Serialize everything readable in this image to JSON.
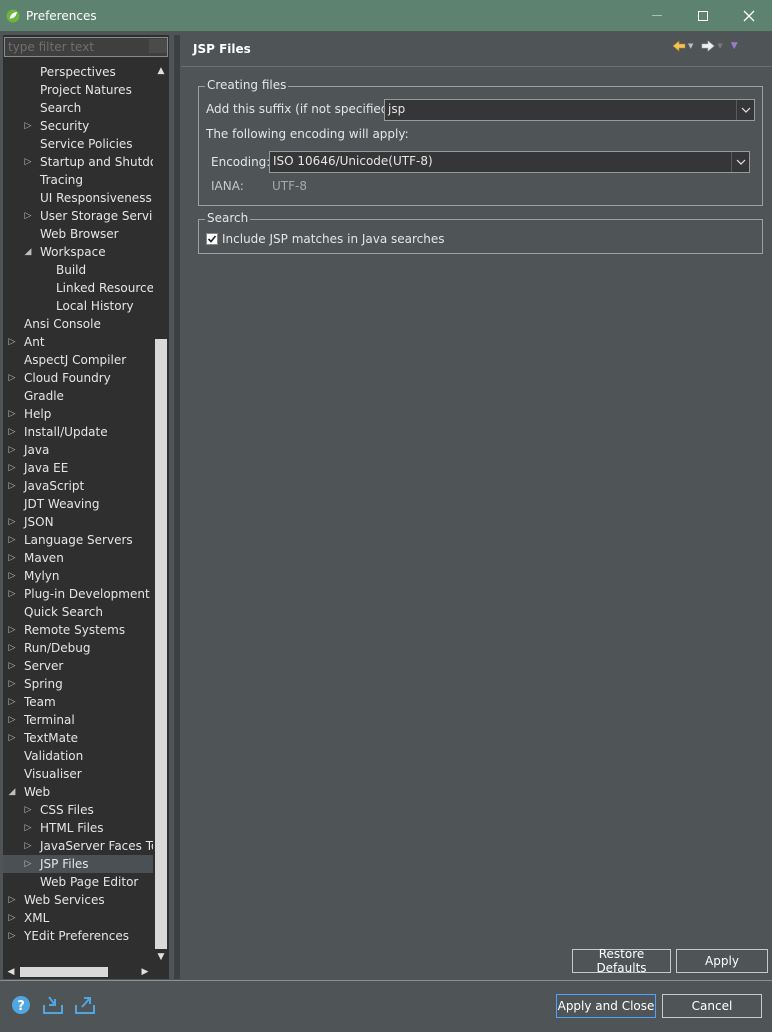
{
  "window": {
    "title": "Preferences"
  },
  "colors": {
    "titlebar": "#5d8270",
    "accent_icon": "#4fa6e0",
    "nav_arrow": "#f3c35a"
  },
  "left": {
    "filter_placeholder": "type filter text",
    "tree": [
      {
        "label": "Perspectives",
        "level": 2,
        "arrow": ""
      },
      {
        "label": "Project Natures",
        "level": 2,
        "arrow": ""
      },
      {
        "label": "Search",
        "level": 2,
        "arrow": ""
      },
      {
        "label": "Security",
        "level": 2,
        "arrow": "collapsed"
      },
      {
        "label": "Service Policies",
        "level": 2,
        "arrow": ""
      },
      {
        "label": "Startup and Shutdown",
        "level": 2,
        "arrow": "collapsed"
      },
      {
        "label": "Tracing",
        "level": 2,
        "arrow": ""
      },
      {
        "label": "UI Responsiveness Monitoring",
        "level": 2,
        "arrow": ""
      },
      {
        "label": "User Storage Service",
        "level": 2,
        "arrow": "collapsed"
      },
      {
        "label": "Web Browser",
        "level": 2,
        "arrow": ""
      },
      {
        "label": "Workspace",
        "level": 2,
        "arrow": "expanded"
      },
      {
        "label": "Build",
        "level": 3,
        "arrow": ""
      },
      {
        "label": "Linked Resources",
        "level": 3,
        "arrow": ""
      },
      {
        "label": "Local History",
        "level": 3,
        "arrow": ""
      },
      {
        "label": "Ansi Console",
        "level": 1,
        "arrow": ""
      },
      {
        "label": "Ant",
        "level": 1,
        "arrow": "collapsed"
      },
      {
        "label": "AspectJ Compiler",
        "level": 1,
        "arrow": ""
      },
      {
        "label": "Cloud Foundry",
        "level": 1,
        "arrow": "collapsed"
      },
      {
        "label": "Gradle",
        "level": 1,
        "arrow": ""
      },
      {
        "label": "Help",
        "level": 1,
        "arrow": "collapsed"
      },
      {
        "label": "Install/Update",
        "level": 1,
        "arrow": "collapsed"
      },
      {
        "label": "Java",
        "level": 1,
        "arrow": "collapsed"
      },
      {
        "label": "Java EE",
        "level": 1,
        "arrow": "collapsed"
      },
      {
        "label": "JavaScript",
        "level": 1,
        "arrow": "collapsed"
      },
      {
        "label": "JDT Weaving",
        "level": 1,
        "arrow": ""
      },
      {
        "label": "JSON",
        "level": 1,
        "arrow": "collapsed"
      },
      {
        "label": "Language Servers",
        "level": 1,
        "arrow": "collapsed"
      },
      {
        "label": "Maven",
        "level": 1,
        "arrow": "collapsed"
      },
      {
        "label": "Mylyn",
        "level": 1,
        "arrow": "collapsed"
      },
      {
        "label": "Plug-in Development",
        "level": 1,
        "arrow": "collapsed"
      },
      {
        "label": "Quick Search",
        "level": 1,
        "arrow": ""
      },
      {
        "label": "Remote Systems",
        "level": 1,
        "arrow": "collapsed"
      },
      {
        "label": "Run/Debug",
        "level": 1,
        "arrow": "collapsed"
      },
      {
        "label": "Server",
        "level": 1,
        "arrow": "collapsed"
      },
      {
        "label": "Spring",
        "level": 1,
        "arrow": "collapsed"
      },
      {
        "label": "Team",
        "level": 1,
        "arrow": "collapsed"
      },
      {
        "label": "Terminal",
        "level": 1,
        "arrow": "collapsed"
      },
      {
        "label": "TextMate",
        "level": 1,
        "arrow": "collapsed"
      },
      {
        "label": "Validation",
        "level": 1,
        "arrow": ""
      },
      {
        "label": "Visualiser",
        "level": 1,
        "arrow": ""
      },
      {
        "label": "Web",
        "level": 1,
        "arrow": "expanded"
      },
      {
        "label": "CSS Files",
        "level": 2,
        "arrow": "collapsed"
      },
      {
        "label": "HTML Files",
        "level": 2,
        "arrow": "collapsed"
      },
      {
        "label": "JavaServer Faces Tools",
        "level": 2,
        "arrow": "collapsed"
      },
      {
        "label": "JSP Files",
        "level": 2,
        "arrow": "collapsed",
        "selected": true
      },
      {
        "label": "Web Page Editor",
        "level": 2,
        "arrow": ""
      },
      {
        "label": "Web Services",
        "level": 1,
        "arrow": "collapsed"
      },
      {
        "label": "XML",
        "level": 1,
        "arrow": "collapsed"
      },
      {
        "label": "YEdit Preferences",
        "level": 1,
        "arrow": "collapsed"
      }
    ]
  },
  "page": {
    "title": "JSP Files",
    "creating_files": {
      "group_label": "Creating files",
      "suffix_label": "Add this suffix (if not specified):",
      "suffix_value": "jsp",
      "encoding_note": "The following encoding will apply:",
      "encoding_label": "Encoding:",
      "encoding_value": "ISO 10646/Unicode(UTF-8)",
      "iana_label": "IANA:",
      "iana_value": "UTF-8"
    },
    "search": {
      "group_label": "Search",
      "checkbox_label": "Include JSP matches in Java searches",
      "checked": true
    },
    "restore_defaults": "Restore Defaults",
    "apply": "Apply"
  },
  "footer": {
    "apply_close": "Apply and Close",
    "cancel": "Cancel",
    "icons": [
      "help-icon",
      "import-icon",
      "export-icon"
    ]
  }
}
